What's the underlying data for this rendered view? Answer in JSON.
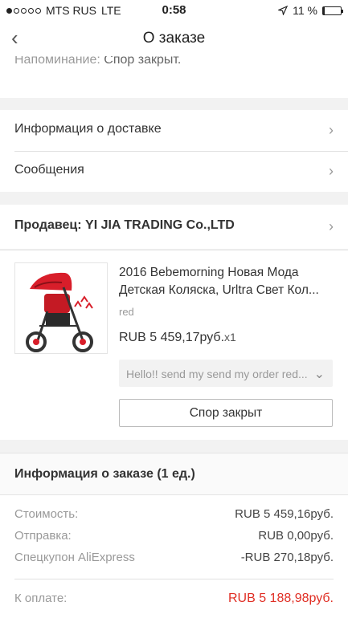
{
  "status_bar": {
    "carrier": "MTS RUS",
    "network": "LTE",
    "time": "0:58",
    "battery": "11 %",
    "battery_level": 0.11,
    "signal_bars_filled": 1,
    "signal_bars_total": 5
  },
  "nav": {
    "back_glyph": "‹",
    "title": "О заказе"
  },
  "reminder": {
    "label": "Напоминание:",
    "value": "Спор закрыт."
  },
  "links": [
    {
      "label": "Информация о доставке",
      "chevron": "›"
    },
    {
      "label": "Сообщения",
      "chevron": "›"
    }
  ],
  "seller": {
    "label": "Продавец: YI JIA TRADING Co.,LTD",
    "chevron": "›"
  },
  "product": {
    "image": "stroller-image",
    "title_line1": "2016 Bebemorning Новая Мода",
    "title_line2": "Детская Коляска, Urltra Свет Кол...",
    "variant": "red",
    "price": "RUB 5 459,17руб.",
    "quantity": "x1",
    "message": "Hello!! send my send my order red...",
    "message_chevron": "⌄",
    "button": "Спор закрыт"
  },
  "summary": {
    "title": "Информация о заказе (1 ед.)",
    "rows": [
      {
        "label": "Стоимость:",
        "value": "RUB 5 459,16руб."
      },
      {
        "label": "Отправка:",
        "value": "RUB 0,00руб."
      },
      {
        "label": "Спецкупон AliExpress",
        "value": "-RUB 270,18руб."
      }
    ],
    "total_label": "К оплате:",
    "total_value": "RUB 5 188,98руб.",
    "total_color": "#e02e24"
  }
}
